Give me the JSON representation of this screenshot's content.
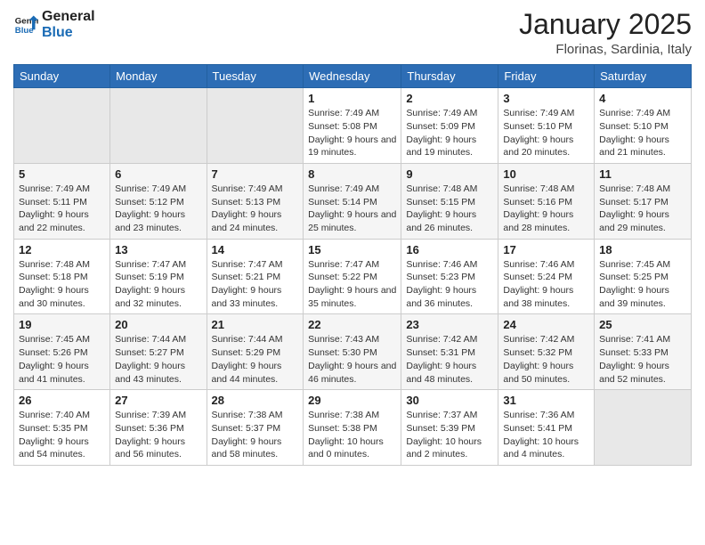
{
  "logo": {
    "line1": "General",
    "line2": "Blue"
  },
  "title": "January 2025",
  "location": "Florinas, Sardinia, Italy",
  "days_of_week": [
    "Sunday",
    "Monday",
    "Tuesday",
    "Wednesday",
    "Thursday",
    "Friday",
    "Saturday"
  ],
  "weeks": [
    [
      {
        "day": "",
        "sunrise": "",
        "sunset": "",
        "daylight": ""
      },
      {
        "day": "",
        "sunrise": "",
        "sunset": "",
        "daylight": ""
      },
      {
        "day": "",
        "sunrise": "",
        "sunset": "",
        "daylight": ""
      },
      {
        "day": "1",
        "sunrise": "Sunrise: 7:49 AM",
        "sunset": "Sunset: 5:08 PM",
        "daylight": "Daylight: 9 hours and 19 minutes."
      },
      {
        "day": "2",
        "sunrise": "Sunrise: 7:49 AM",
        "sunset": "Sunset: 5:09 PM",
        "daylight": "Daylight: 9 hours and 19 minutes."
      },
      {
        "day": "3",
        "sunrise": "Sunrise: 7:49 AM",
        "sunset": "Sunset: 5:10 PM",
        "daylight": "Daylight: 9 hours and 20 minutes."
      },
      {
        "day": "4",
        "sunrise": "Sunrise: 7:49 AM",
        "sunset": "Sunset: 5:10 PM",
        "daylight": "Daylight: 9 hours and 21 minutes."
      }
    ],
    [
      {
        "day": "5",
        "sunrise": "Sunrise: 7:49 AM",
        "sunset": "Sunset: 5:11 PM",
        "daylight": "Daylight: 9 hours and 22 minutes."
      },
      {
        "day": "6",
        "sunrise": "Sunrise: 7:49 AM",
        "sunset": "Sunset: 5:12 PM",
        "daylight": "Daylight: 9 hours and 23 minutes."
      },
      {
        "day": "7",
        "sunrise": "Sunrise: 7:49 AM",
        "sunset": "Sunset: 5:13 PM",
        "daylight": "Daylight: 9 hours and 24 minutes."
      },
      {
        "day": "8",
        "sunrise": "Sunrise: 7:49 AM",
        "sunset": "Sunset: 5:14 PM",
        "daylight": "Daylight: 9 hours and 25 minutes."
      },
      {
        "day": "9",
        "sunrise": "Sunrise: 7:48 AM",
        "sunset": "Sunset: 5:15 PM",
        "daylight": "Daylight: 9 hours and 26 minutes."
      },
      {
        "day": "10",
        "sunrise": "Sunrise: 7:48 AM",
        "sunset": "Sunset: 5:16 PM",
        "daylight": "Daylight: 9 hours and 28 minutes."
      },
      {
        "day": "11",
        "sunrise": "Sunrise: 7:48 AM",
        "sunset": "Sunset: 5:17 PM",
        "daylight": "Daylight: 9 hours and 29 minutes."
      }
    ],
    [
      {
        "day": "12",
        "sunrise": "Sunrise: 7:48 AM",
        "sunset": "Sunset: 5:18 PM",
        "daylight": "Daylight: 9 hours and 30 minutes."
      },
      {
        "day": "13",
        "sunrise": "Sunrise: 7:47 AM",
        "sunset": "Sunset: 5:19 PM",
        "daylight": "Daylight: 9 hours and 32 minutes."
      },
      {
        "day": "14",
        "sunrise": "Sunrise: 7:47 AM",
        "sunset": "Sunset: 5:21 PM",
        "daylight": "Daylight: 9 hours and 33 minutes."
      },
      {
        "day": "15",
        "sunrise": "Sunrise: 7:47 AM",
        "sunset": "Sunset: 5:22 PM",
        "daylight": "Daylight: 9 hours and 35 minutes."
      },
      {
        "day": "16",
        "sunrise": "Sunrise: 7:46 AM",
        "sunset": "Sunset: 5:23 PM",
        "daylight": "Daylight: 9 hours and 36 minutes."
      },
      {
        "day": "17",
        "sunrise": "Sunrise: 7:46 AM",
        "sunset": "Sunset: 5:24 PM",
        "daylight": "Daylight: 9 hours and 38 minutes."
      },
      {
        "day": "18",
        "sunrise": "Sunrise: 7:45 AM",
        "sunset": "Sunset: 5:25 PM",
        "daylight": "Daylight: 9 hours and 39 minutes."
      }
    ],
    [
      {
        "day": "19",
        "sunrise": "Sunrise: 7:45 AM",
        "sunset": "Sunset: 5:26 PM",
        "daylight": "Daylight: 9 hours and 41 minutes."
      },
      {
        "day": "20",
        "sunrise": "Sunrise: 7:44 AM",
        "sunset": "Sunset: 5:27 PM",
        "daylight": "Daylight: 9 hours and 43 minutes."
      },
      {
        "day": "21",
        "sunrise": "Sunrise: 7:44 AM",
        "sunset": "Sunset: 5:29 PM",
        "daylight": "Daylight: 9 hours and 44 minutes."
      },
      {
        "day": "22",
        "sunrise": "Sunrise: 7:43 AM",
        "sunset": "Sunset: 5:30 PM",
        "daylight": "Daylight: 9 hours and 46 minutes."
      },
      {
        "day": "23",
        "sunrise": "Sunrise: 7:42 AM",
        "sunset": "Sunset: 5:31 PM",
        "daylight": "Daylight: 9 hours and 48 minutes."
      },
      {
        "day": "24",
        "sunrise": "Sunrise: 7:42 AM",
        "sunset": "Sunset: 5:32 PM",
        "daylight": "Daylight: 9 hours and 50 minutes."
      },
      {
        "day": "25",
        "sunrise": "Sunrise: 7:41 AM",
        "sunset": "Sunset: 5:33 PM",
        "daylight": "Daylight: 9 hours and 52 minutes."
      }
    ],
    [
      {
        "day": "26",
        "sunrise": "Sunrise: 7:40 AM",
        "sunset": "Sunset: 5:35 PM",
        "daylight": "Daylight: 9 hours and 54 minutes."
      },
      {
        "day": "27",
        "sunrise": "Sunrise: 7:39 AM",
        "sunset": "Sunset: 5:36 PM",
        "daylight": "Daylight: 9 hours and 56 minutes."
      },
      {
        "day": "28",
        "sunrise": "Sunrise: 7:38 AM",
        "sunset": "Sunset: 5:37 PM",
        "daylight": "Daylight: 9 hours and 58 minutes."
      },
      {
        "day": "29",
        "sunrise": "Sunrise: 7:38 AM",
        "sunset": "Sunset: 5:38 PM",
        "daylight": "Daylight: 10 hours and 0 minutes."
      },
      {
        "day": "30",
        "sunrise": "Sunrise: 7:37 AM",
        "sunset": "Sunset: 5:39 PM",
        "daylight": "Daylight: 10 hours and 2 minutes."
      },
      {
        "day": "31",
        "sunrise": "Sunrise: 7:36 AM",
        "sunset": "Sunset: 5:41 PM",
        "daylight": "Daylight: 10 hours and 4 minutes."
      },
      {
        "day": "",
        "sunrise": "",
        "sunset": "",
        "daylight": ""
      }
    ]
  ]
}
